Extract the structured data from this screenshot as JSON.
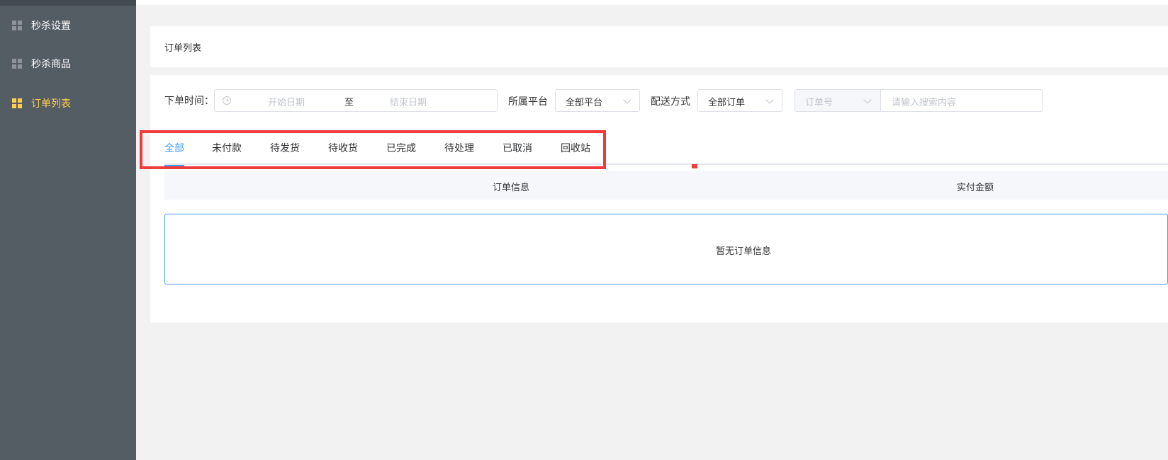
{
  "sidebar": {
    "items": [
      {
        "label": "秒杀设置",
        "icon": "grid-icon",
        "active": false
      },
      {
        "label": "秒杀商品",
        "icon": "grid-icon",
        "active": false
      },
      {
        "label": "订单列表",
        "icon": "grid-icon",
        "active": true
      }
    ]
  },
  "header": {
    "title": "订单列表"
  },
  "filters": {
    "order_time_label": "下单时间：",
    "start_placeholder": "开始日期",
    "range_separator": "至",
    "end_placeholder": "结束日期",
    "platform_label": "所属平台",
    "platform_value": "全部平台",
    "delivery_label": "配送方式",
    "delivery_value": "全部订单",
    "search_field_value": "订单号",
    "search_placeholder": "请输入搜索内容"
  },
  "tabs": [
    {
      "label": "全部",
      "active": true
    },
    {
      "label": "未付款",
      "active": false
    },
    {
      "label": "待发货",
      "active": false
    },
    {
      "label": "待收货",
      "active": false
    },
    {
      "label": "已完成",
      "active": false
    },
    {
      "label": "待处理",
      "active": false
    },
    {
      "label": "已取消",
      "active": false
    },
    {
      "label": "回收站",
      "active": false
    }
  ],
  "table": {
    "columns": [
      "订单信息",
      "实付金额"
    ],
    "empty_text": "暂无订单信息"
  },
  "colors": {
    "sidebar_bg": "#545c64",
    "active_menu": "#ffd04b",
    "accent": "#409eff",
    "highlight": "#ef3b3b"
  }
}
